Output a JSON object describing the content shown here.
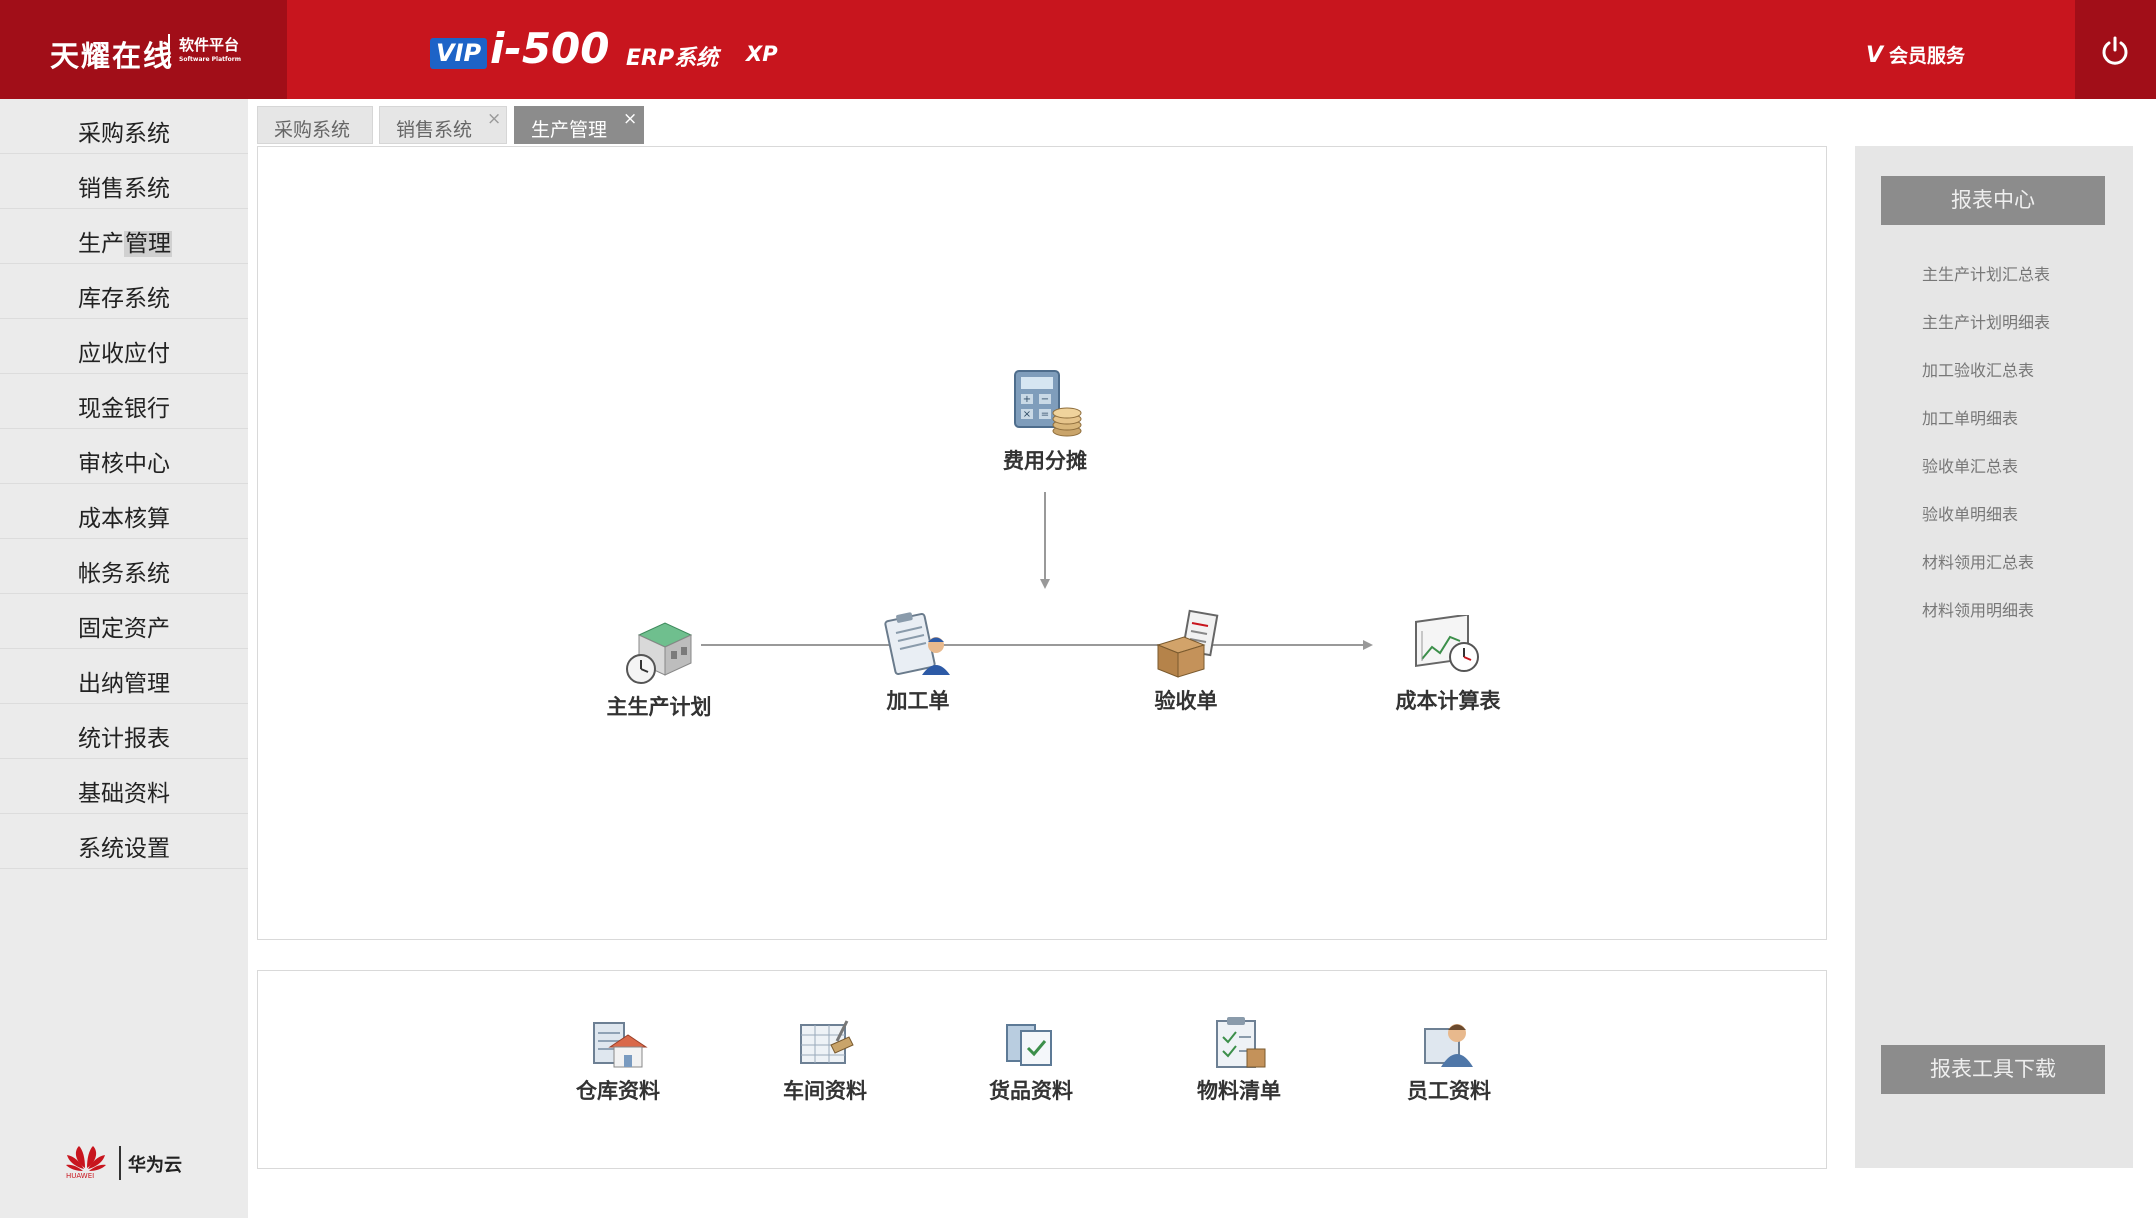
{
  "header": {
    "brand_name": "天耀在线",
    "brand_sub": "软件平台",
    "brand_sub_en": "Software Platform",
    "vip": "VIP",
    "product": "i-500",
    "erp": "ERP系统",
    "xp": "XP",
    "member_v": "V",
    "member_label": "会员服务",
    "power_icon": "power-icon",
    "accent_color": "#c8151e",
    "dark_accent_color": "#a10e18"
  },
  "sidebar": {
    "items": [
      {
        "label": "采购系统"
      },
      {
        "label": "销售系统"
      },
      {
        "label_a": "生产",
        "label_b": "管理"
      },
      {
        "label": "库存系统"
      },
      {
        "label": "应收应付"
      },
      {
        "label": "现金银行"
      },
      {
        "label": "审核中心"
      },
      {
        "label": "成本核算"
      },
      {
        "label": "帐务系统"
      },
      {
        "label": "固定资产"
      },
      {
        "label": "出纳管理"
      },
      {
        "label": "统计报表"
      },
      {
        "label": "基础资料"
      },
      {
        "label": "系统设置"
      }
    ],
    "footer": {
      "logo_en": "HUAWEI",
      "logo_cn": "华为云"
    }
  },
  "tabs": [
    {
      "label": "采购系统",
      "active": false,
      "closable": false
    },
    {
      "label": "销售系统",
      "active": false,
      "closable": true
    },
    {
      "label": "生产管理",
      "active": true,
      "closable": true
    }
  ],
  "tab_close_symbol": "×",
  "flow": {
    "nodes": [
      {
        "label": "费用分摊",
        "icon": "calculator-coins-icon"
      },
      {
        "label": "主生产计划",
        "icon": "factory-clock-icon"
      },
      {
        "label": "加工单",
        "icon": "clipboard-worker-icon"
      },
      {
        "label": "验收单",
        "icon": "box-checklist-icon"
      },
      {
        "label": "成本计算表",
        "icon": "chart-clock-icon"
      }
    ]
  },
  "quick_links": [
    {
      "label": "仓库资料",
      "icon": "warehouse-icon"
    },
    {
      "label": "车间资料",
      "icon": "workshop-icon"
    },
    {
      "label": "货品资料",
      "icon": "goods-icon"
    },
    {
      "label": "物料清单",
      "icon": "material-list-icon"
    },
    {
      "label": "员工资料",
      "icon": "employee-icon"
    }
  ],
  "reports": {
    "title": "报表中心",
    "links": [
      "主生产计划汇总表",
      "主生产计划明细表",
      "加工验收汇总表",
      "加工单明细表",
      "验收单汇总表",
      "验收单明细表",
      "材料领用汇总表",
      "材料领用明细表"
    ],
    "download": "报表工具下载"
  }
}
